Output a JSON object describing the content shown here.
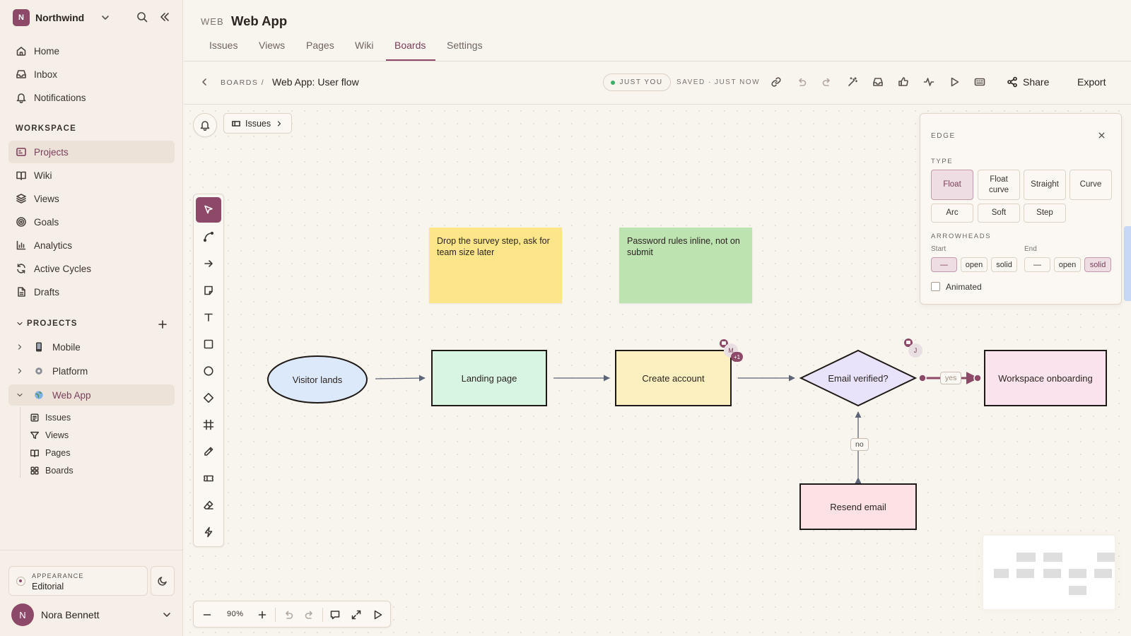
{
  "colors": {
    "accent": "#8c4a68",
    "background": "#f8f4ee",
    "sidebar": "#f6efe7"
  },
  "org": {
    "initial": "N",
    "name": "Northwind"
  },
  "nav": {
    "top": [
      {
        "label": "Home",
        "icon": "home-icon"
      },
      {
        "label": "Inbox",
        "icon": "inbox-icon"
      },
      {
        "label": "Notifications",
        "icon": "bell-icon"
      }
    ],
    "workspace_label": "WORKSPACE",
    "workspace": [
      {
        "label": "Projects",
        "icon": "projects-icon",
        "active": true
      },
      {
        "label": "Wiki",
        "icon": "book-icon"
      },
      {
        "label": "Views",
        "icon": "layers-icon"
      },
      {
        "label": "Goals",
        "icon": "target-icon"
      },
      {
        "label": "Analytics",
        "icon": "bar-chart-icon"
      },
      {
        "label": "Active Cycles",
        "icon": "cycle-icon"
      },
      {
        "label": "Drafts",
        "icon": "draft-icon"
      }
    ],
    "projects_label": "PROJECTS",
    "projects": [
      {
        "label": "Mobile",
        "icon": "phone-icon"
      },
      {
        "label": "Platform",
        "icon": "gear-icon"
      },
      {
        "label": "Web App",
        "icon": "globe-icon",
        "active": true
      }
    ],
    "webapp_children": [
      {
        "label": "Issues",
        "icon": "issues-icon"
      },
      {
        "label": "Views",
        "icon": "filter-icon"
      },
      {
        "label": "Pages",
        "icon": "book-icon"
      },
      {
        "label": "Boards",
        "icon": "grid-icon"
      }
    ]
  },
  "appearance": {
    "label": "APPEARANCE",
    "value": "Editorial"
  },
  "user": {
    "initial": "N",
    "name": "Nora Bennett"
  },
  "header": {
    "project_code": "WEB",
    "project_name": "Web App",
    "tabs": [
      "Issues",
      "Views",
      "Pages",
      "Wiki",
      "Boards",
      "Settings"
    ],
    "active_tab": "Boards"
  },
  "toolbar": {
    "breadcrumb_root": "BOARDS /",
    "board_title": "Web App: User flow",
    "presence": "JUST YOU",
    "saved_status": "SAVED · JUST NOW",
    "share_label": "Share",
    "export_label": "Export"
  },
  "canvas": {
    "issues_chip": "Issues",
    "stickies": [
      {
        "text": "Drop the survey step, ask for team size later",
        "color": "yellow"
      },
      {
        "text": "Password rules inline, not on submit",
        "color": "green"
      }
    ],
    "nodes": {
      "visitor": "Visitor lands",
      "landing": "Landing page",
      "create": "Create account",
      "verified": "Email verified?",
      "onboarding": "Workspace onboarding",
      "resend": "Resend email"
    },
    "edge_labels": {
      "yes": "yes",
      "no": "no"
    },
    "avatars": {
      "m": "M",
      "j": "J",
      "more": "+1"
    }
  },
  "edge_panel": {
    "title": "EDGE",
    "type_label": "TYPE",
    "types": [
      {
        "label": "Float",
        "selected": true
      },
      {
        "label": "Float curve"
      },
      {
        "label": "Straight"
      },
      {
        "label": "Curve"
      },
      {
        "label": "Arc"
      },
      {
        "label": "Soft"
      },
      {
        "label": "Step"
      }
    ],
    "arrowheads_label": "ARROWHEADS",
    "start_label": "Start",
    "end_label": "End",
    "start_options": [
      "—",
      "open",
      "solid"
    ],
    "start_selected": "—",
    "end_options": [
      "—",
      "open",
      "solid"
    ],
    "end_selected": "solid",
    "animated_label": "Animated",
    "animated": false
  },
  "zoom": {
    "level": "90%"
  }
}
